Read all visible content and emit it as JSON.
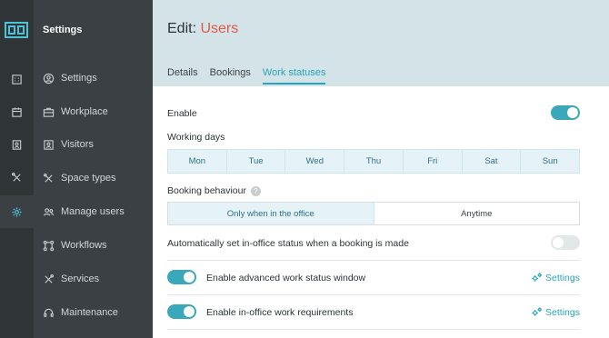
{
  "sidebar": {
    "title": "Settings",
    "items": [
      {
        "label": "Settings",
        "icon": "user-circle-icon"
      },
      {
        "label": "Workplace",
        "icon": "briefcase-icon"
      },
      {
        "label": "Visitors",
        "icon": "visitor-badge-icon"
      },
      {
        "label": "Space types",
        "icon": "tools-icon"
      },
      {
        "label": "Manage users",
        "icon": "users-icon"
      },
      {
        "label": "Workflows",
        "icon": "workflow-icon"
      },
      {
        "label": "Services",
        "icon": "tools-icon"
      },
      {
        "label": "Maintenance",
        "icon": "headset-icon"
      }
    ]
  },
  "rail": {
    "icons": [
      "building-icon",
      "calendar-icon",
      "id-badge-icon",
      "tools-icon",
      "gear-icon"
    ]
  },
  "header": {
    "title_prefix": "Edit:",
    "title_entity": "Users",
    "tabs": [
      {
        "label": "Details",
        "active": false
      },
      {
        "label": "Bookings",
        "active": false
      },
      {
        "label": "Work statuses",
        "active": true
      }
    ]
  },
  "form": {
    "enable_label": "Enable",
    "enable_on": true,
    "working_days_label": "Working days",
    "days": [
      "Mon",
      "Tue",
      "Wed",
      "Thu",
      "Fri",
      "Sat",
      "Sun"
    ],
    "booking_behaviour_label": "Booking behaviour",
    "booking_options": [
      "Only when in the office",
      "Anytime"
    ],
    "booking_selected": "Only when in the office",
    "auto_status_label": "Automatically set in-office status when a booking is made",
    "auto_status_on": false,
    "advanced_label": "Enable advanced work status window",
    "advanced_on": true,
    "advanced_settings_label": "Settings",
    "requirements_label": "Enable in-office work requirements",
    "requirements_on": true,
    "requirements_settings_label": "Settings"
  },
  "colors": {
    "accent": "#26a6bd",
    "title_accent": "#e05a4a",
    "rail": "#2f3437",
    "sidebar": "#3a4043",
    "header_bg": "#d4e3e8"
  }
}
